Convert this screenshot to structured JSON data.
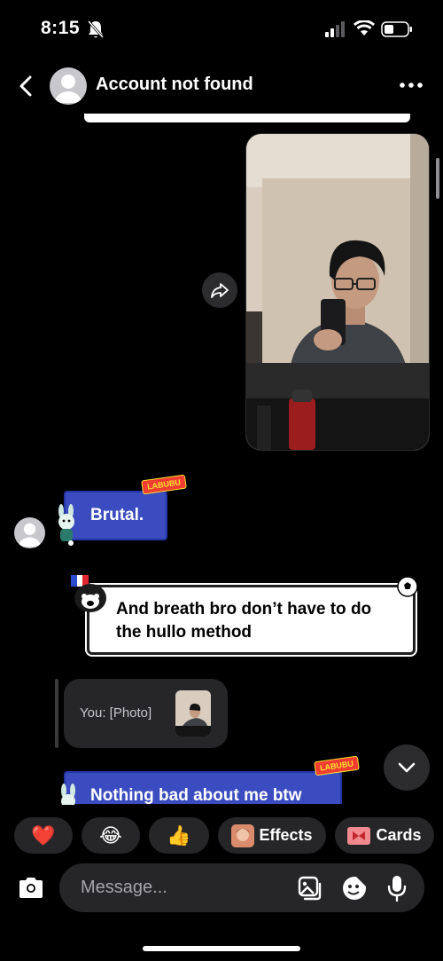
{
  "status_bar": {
    "time": "8:15"
  },
  "header": {
    "title": "Account not found"
  },
  "messages": {
    "brutal": "Brutal.",
    "breath": "And breath bro don’t have to do the hullo method",
    "reply_preview": "You: [Photo]",
    "nothing_bad": "Nothing bad about me btw",
    "sticker_tag": "LABUBU"
  },
  "quick_actions": {
    "heart": "❤️",
    "laugh": "😂",
    "thumbs": "👍",
    "effects": "Effects",
    "cards": "Cards"
  },
  "composer": {
    "placeholder": "Message..."
  },
  "colors": {
    "background": "#000000",
    "received_bubble": "#3b4cc0",
    "chip_bg": "#262628"
  }
}
